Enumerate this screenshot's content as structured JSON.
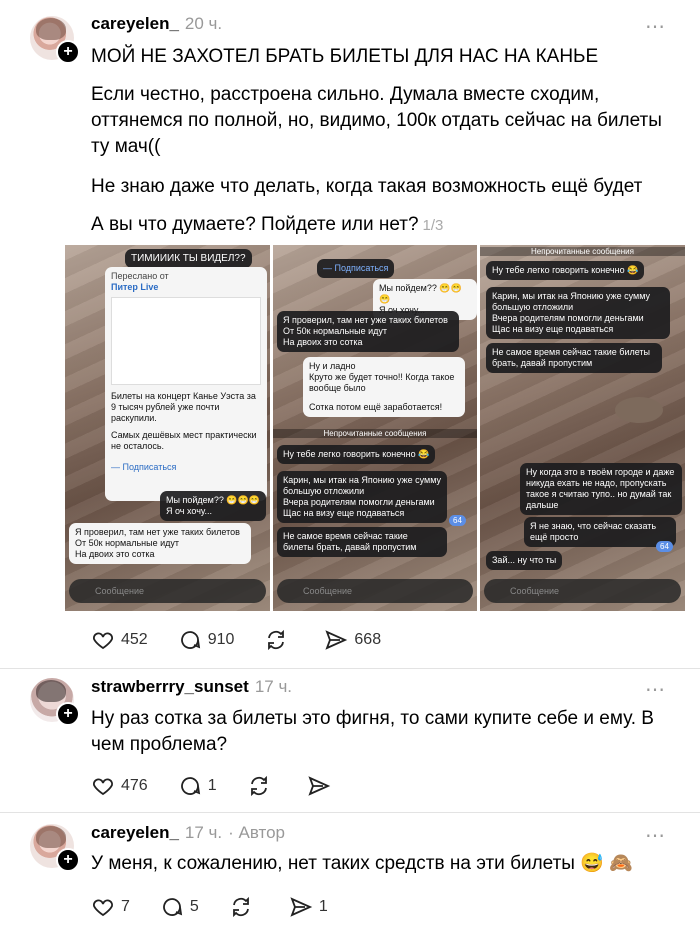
{
  "post1": {
    "username": "careyelen_",
    "time": "20 ч.",
    "title": "МОЙ НЕ ЗАХОТЕЛ БРАТЬ БИЛЕТЫ ДЛЯ НАС НА КАНЬЕ",
    "p1": "Если честно, расстроена сильно. Думала вместе сходим, оттянемся по полной, но, видимо, 100к отдать сейчас на билеты ту мач((",
    "p2": "Не знаю даже что делать, когда такая возможность ещё будет",
    "p3": "А вы что думаете? Пойдете или нет?",
    "counter": "1/3",
    "likes": "452",
    "comments": "910",
    "shares": "668",
    "shot1": {
      "top": "ТИМИИИК ТЫ ВИДЕЛ??",
      "fwd": "Переслано от",
      "src": "Питер Live",
      "news": "Билеты на концерт Канье Уэста за 9 тысяч рублей уже почти раскупили.",
      "news2": "Самых дешёвых мест практически не осталось.",
      "sub": "— Подписаться",
      "m1": "Мы пойдем?? 😁😁😁",
      "m2": "Я оч хочу...",
      "m3": "Я проверил, там нет уже таких билетов",
      "m4": "От 50к нормальные идут",
      "m5": "На двоих это сотка",
      "input": "Сообщение"
    },
    "shot2": {
      "sub": "— Подписаться",
      "m1": "Мы пойдем?? 😁😁😁",
      "m2": "Я оч хочу...",
      "m3": "Я проверил, там нет уже таких билетов",
      "m4": "От 50к нормальные идут",
      "m5": "На двоих это сотка",
      "m6": "Ну и ладно",
      "m7": "Круто же будет точно!! Когда такое вообще было",
      "m8": "Сотка потом ещё заработается!",
      "unread": "Непрочитанные сообщения",
      "m9": "Ну тебе легко говорить конечно 😂",
      "m10": "Карин, мы итак на Японию уже сумму большую отложили",
      "m11": "Вчера родителям помогли деньгами",
      "m12": "Щас на визу еще подаваться",
      "m13": "Не самое время сейчас такие билеты брать, давай пропустим",
      "input": "Сообщение"
    },
    "shot3": {
      "unread": "Непрочитанные сообщения",
      "m1": "Ну тебе легко говорить конечно 😂",
      "m2": "Карин, мы итак на Японию уже сумму большую отложили",
      "m3": "Вчера родителям помогли деньгами",
      "m4": "Щас на визу еще подаваться",
      "m5": "Не самое время сейчас такие билеты брать, давай пропустим",
      "m6": "Ну когда это в твоём городе и даже никуда ехать не надо, пропускать такое я считаю тупо.. но думай так дальше",
      "m7": "Я не знаю, что сейчас сказать ещё просто",
      "m8": "Зай... ну что ты",
      "input": "Сообщение"
    }
  },
  "post2": {
    "username": "strawberrry_sunset",
    "time": "17 ч.",
    "text": "Ну раз сотка за билеты это фигня, то сами купите себе и ему. В чем проблема?",
    "likes": "476",
    "comments": "1"
  },
  "post3": {
    "username": "careyelen_",
    "time": "17 ч.",
    "author": "· Автор",
    "text": "У меня, к сожалению, нет таких средств на эти билеты 😅 🙈",
    "likes": "7",
    "comments": "5",
    "shares": "1"
  },
  "more_icon": "⋯"
}
